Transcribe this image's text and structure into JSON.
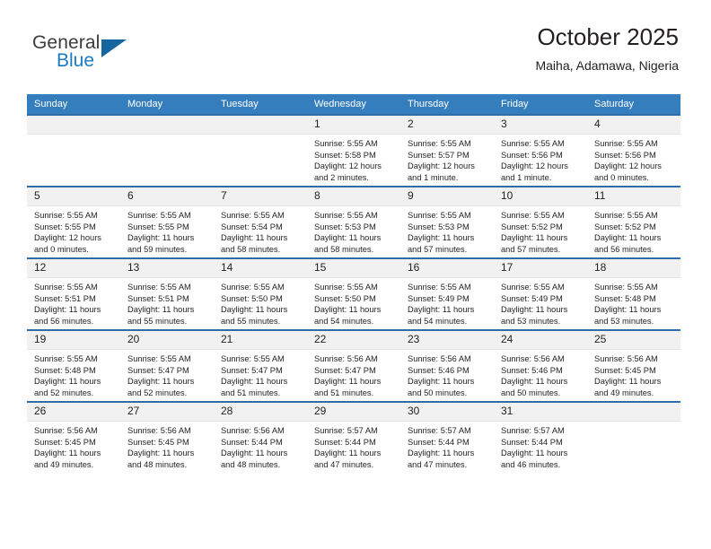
{
  "brand": {
    "name_top": "General",
    "name_bottom": "Blue",
    "triangle_color": "#15659f",
    "blue_color": "#1a7cc4"
  },
  "header": {
    "title": "October 2025",
    "subtitle": "Maiha, Adamawa, Nigeria"
  },
  "theme": {
    "header_row_bg": "#357ebd",
    "row_border": "#2f6ca8",
    "daynum_bg": "#f1f1f1",
    "text": "#231f20"
  },
  "calendar": {
    "weekday_headers": [
      "Sunday",
      "Monday",
      "Tuesday",
      "Wednesday",
      "Thursday",
      "Friday",
      "Saturday"
    ],
    "weeks": [
      [
        {
          "day": "",
          "blank": true
        },
        {
          "day": "",
          "blank": true
        },
        {
          "day": "",
          "blank": true
        },
        {
          "day": "1",
          "sunrise": "Sunrise: 5:55 AM",
          "sunset": "Sunset: 5:58 PM",
          "daylight": "Daylight: 12 hours and 2 minutes."
        },
        {
          "day": "2",
          "sunrise": "Sunrise: 5:55 AM",
          "sunset": "Sunset: 5:57 PM",
          "daylight": "Daylight: 12 hours and 1 minute."
        },
        {
          "day": "3",
          "sunrise": "Sunrise: 5:55 AM",
          "sunset": "Sunset: 5:56 PM",
          "daylight": "Daylight: 12 hours and 1 minute."
        },
        {
          "day": "4",
          "sunrise": "Sunrise: 5:55 AM",
          "sunset": "Sunset: 5:56 PM",
          "daylight": "Daylight: 12 hours and 0 minutes."
        }
      ],
      [
        {
          "day": "5",
          "sunrise": "Sunrise: 5:55 AM",
          "sunset": "Sunset: 5:55 PM",
          "daylight": "Daylight: 12 hours and 0 minutes."
        },
        {
          "day": "6",
          "sunrise": "Sunrise: 5:55 AM",
          "sunset": "Sunset: 5:55 PM",
          "daylight": "Daylight: 11 hours and 59 minutes."
        },
        {
          "day": "7",
          "sunrise": "Sunrise: 5:55 AM",
          "sunset": "Sunset: 5:54 PM",
          "daylight": "Daylight: 11 hours and 58 minutes."
        },
        {
          "day": "8",
          "sunrise": "Sunrise: 5:55 AM",
          "sunset": "Sunset: 5:53 PM",
          "daylight": "Daylight: 11 hours and 58 minutes."
        },
        {
          "day": "9",
          "sunrise": "Sunrise: 5:55 AM",
          "sunset": "Sunset: 5:53 PM",
          "daylight": "Daylight: 11 hours and 57 minutes."
        },
        {
          "day": "10",
          "sunrise": "Sunrise: 5:55 AM",
          "sunset": "Sunset: 5:52 PM",
          "daylight": "Daylight: 11 hours and 57 minutes."
        },
        {
          "day": "11",
          "sunrise": "Sunrise: 5:55 AM",
          "sunset": "Sunset: 5:52 PM",
          "daylight": "Daylight: 11 hours and 56 minutes."
        }
      ],
      [
        {
          "day": "12",
          "sunrise": "Sunrise: 5:55 AM",
          "sunset": "Sunset: 5:51 PM",
          "daylight": "Daylight: 11 hours and 56 minutes."
        },
        {
          "day": "13",
          "sunrise": "Sunrise: 5:55 AM",
          "sunset": "Sunset: 5:51 PM",
          "daylight": "Daylight: 11 hours and 55 minutes."
        },
        {
          "day": "14",
          "sunrise": "Sunrise: 5:55 AM",
          "sunset": "Sunset: 5:50 PM",
          "daylight": "Daylight: 11 hours and 55 minutes."
        },
        {
          "day": "15",
          "sunrise": "Sunrise: 5:55 AM",
          "sunset": "Sunset: 5:50 PM",
          "daylight": "Daylight: 11 hours and 54 minutes."
        },
        {
          "day": "16",
          "sunrise": "Sunrise: 5:55 AM",
          "sunset": "Sunset: 5:49 PM",
          "daylight": "Daylight: 11 hours and 54 minutes."
        },
        {
          "day": "17",
          "sunrise": "Sunrise: 5:55 AM",
          "sunset": "Sunset: 5:49 PM",
          "daylight": "Daylight: 11 hours and 53 minutes."
        },
        {
          "day": "18",
          "sunrise": "Sunrise: 5:55 AM",
          "sunset": "Sunset: 5:48 PM",
          "daylight": "Daylight: 11 hours and 53 minutes."
        }
      ],
      [
        {
          "day": "19",
          "sunrise": "Sunrise: 5:55 AM",
          "sunset": "Sunset: 5:48 PM",
          "daylight": "Daylight: 11 hours and 52 minutes."
        },
        {
          "day": "20",
          "sunrise": "Sunrise: 5:55 AM",
          "sunset": "Sunset: 5:47 PM",
          "daylight": "Daylight: 11 hours and 52 minutes."
        },
        {
          "day": "21",
          "sunrise": "Sunrise: 5:55 AM",
          "sunset": "Sunset: 5:47 PM",
          "daylight": "Daylight: 11 hours and 51 minutes."
        },
        {
          "day": "22",
          "sunrise": "Sunrise: 5:56 AM",
          "sunset": "Sunset: 5:47 PM",
          "daylight": "Daylight: 11 hours and 51 minutes."
        },
        {
          "day": "23",
          "sunrise": "Sunrise: 5:56 AM",
          "sunset": "Sunset: 5:46 PM",
          "daylight": "Daylight: 11 hours and 50 minutes."
        },
        {
          "day": "24",
          "sunrise": "Sunrise: 5:56 AM",
          "sunset": "Sunset: 5:46 PM",
          "daylight": "Daylight: 11 hours and 50 minutes."
        },
        {
          "day": "25",
          "sunrise": "Sunrise: 5:56 AM",
          "sunset": "Sunset: 5:45 PM",
          "daylight": "Daylight: 11 hours and 49 minutes."
        }
      ],
      [
        {
          "day": "26",
          "sunrise": "Sunrise: 5:56 AM",
          "sunset": "Sunset: 5:45 PM",
          "daylight": "Daylight: 11 hours and 49 minutes."
        },
        {
          "day": "27",
          "sunrise": "Sunrise: 5:56 AM",
          "sunset": "Sunset: 5:45 PM",
          "daylight": "Daylight: 11 hours and 48 minutes."
        },
        {
          "day": "28",
          "sunrise": "Sunrise: 5:56 AM",
          "sunset": "Sunset: 5:44 PM",
          "daylight": "Daylight: 11 hours and 48 minutes."
        },
        {
          "day": "29",
          "sunrise": "Sunrise: 5:57 AM",
          "sunset": "Sunset: 5:44 PM",
          "daylight": "Daylight: 11 hours and 47 minutes."
        },
        {
          "day": "30",
          "sunrise": "Sunrise: 5:57 AM",
          "sunset": "Sunset: 5:44 PM",
          "daylight": "Daylight: 11 hours and 47 minutes."
        },
        {
          "day": "31",
          "sunrise": "Sunrise: 5:57 AM",
          "sunset": "Sunset: 5:44 PM",
          "daylight": "Daylight: 11 hours and 46 minutes."
        },
        {
          "day": "",
          "blank": true
        }
      ]
    ]
  }
}
